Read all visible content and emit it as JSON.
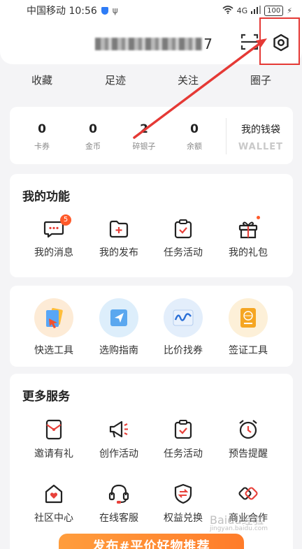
{
  "status_bar": {
    "carrier_time": "中国移动 10:56",
    "network": "4G",
    "battery": "100"
  },
  "header": {
    "username_tail": "7"
  },
  "quick_stats": [
    {
      "label": "收藏"
    },
    {
      "label": "足迹"
    },
    {
      "label": "关注"
    },
    {
      "label": "圈子"
    }
  ],
  "wallet": {
    "stats": [
      {
        "value": "0",
        "label": "卡券"
      },
      {
        "value": "0",
        "label": "金币"
      },
      {
        "value": "2",
        "label": "碎银子"
      },
      {
        "value": "0",
        "label": "余额"
      }
    ],
    "title": "我的钱袋",
    "subtitle": "WALLET"
  },
  "my_functions": {
    "title": "我的功能",
    "items": [
      {
        "label": "我的消息",
        "icon": "message-icon",
        "badge": "5"
      },
      {
        "label": "我的发布",
        "icon": "publish-icon"
      },
      {
        "label": "任务活动",
        "icon": "task-icon"
      },
      {
        "label": "我的礼包",
        "icon": "gift-icon"
      }
    ]
  },
  "tools": {
    "items": [
      {
        "label": "快选工具",
        "icon": "quick-select-icon"
      },
      {
        "label": "选购指南",
        "icon": "guide-icon"
      },
      {
        "label": "比价找券",
        "icon": "price-compare-icon"
      },
      {
        "label": "签证工具",
        "icon": "passport-icon"
      }
    ]
  },
  "more_services": {
    "title": "更多服务",
    "items": [
      {
        "label": "邀请有礼",
        "icon": "invite-icon"
      },
      {
        "label": "创作活动",
        "icon": "megaphone-icon"
      },
      {
        "label": "任务活动",
        "icon": "task-icon"
      },
      {
        "label": "预告提醒",
        "icon": "alarm-clock-icon"
      },
      {
        "label": "社区中心",
        "icon": "community-icon"
      },
      {
        "label": "在线客服",
        "icon": "headset-icon"
      },
      {
        "label": "权益兑换",
        "icon": "exchange-shield-icon"
      },
      {
        "label": "商业合作",
        "icon": "cooperation-icon"
      }
    ]
  },
  "banner": {
    "text": "发布#平价好物推荐"
  },
  "watermark": {
    "line1": "Baidu经验",
    "line2": "jingyan.baidu.com"
  },
  "colors": {
    "accent": "#e8413a",
    "highlight_box": "#e53935",
    "banner": "#ff8a33"
  }
}
